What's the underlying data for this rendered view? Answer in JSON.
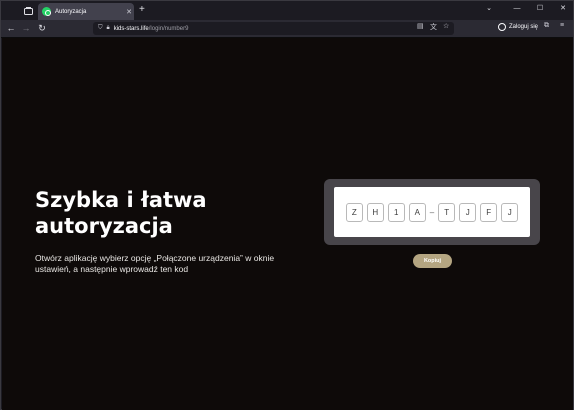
{
  "browser": {
    "tab": {
      "title": "Autoryzacja",
      "close": "✕"
    },
    "new_tab": "+",
    "window_controls": {
      "list": "⌄",
      "minimize": "—",
      "maximize": "☐",
      "close": "✕"
    },
    "nav": {
      "back": "←",
      "forward": "→",
      "reload": "↻"
    },
    "url": {
      "host": "kids-stars.life",
      "path": "/login/number9"
    },
    "login_label": "Zaloguj się",
    "icons": [
      "tab-overview-icon",
      "shield-icon",
      "lock-icon",
      "reader-view-icon",
      "translate-icon",
      "star-icon",
      "extensions-icon",
      "menu-icon"
    ]
  },
  "page": {
    "heading": "Szybka i łatwa autoryzacja",
    "description": "Otwórz aplikację wybierz opcję „Połączone urządzenia” w oknie ustawień, a następnie wprowadź ten kod",
    "code": {
      "first": [
        "Z",
        "H",
        "1",
        "A"
      ],
      "separator": "–",
      "second": [
        "T",
        "J",
        "F",
        "J"
      ]
    },
    "copy_button": "Kopiuj",
    "colors": {
      "background": "#0e0a09",
      "code_frame": "#48454a",
      "button": "#b4a581"
    }
  }
}
